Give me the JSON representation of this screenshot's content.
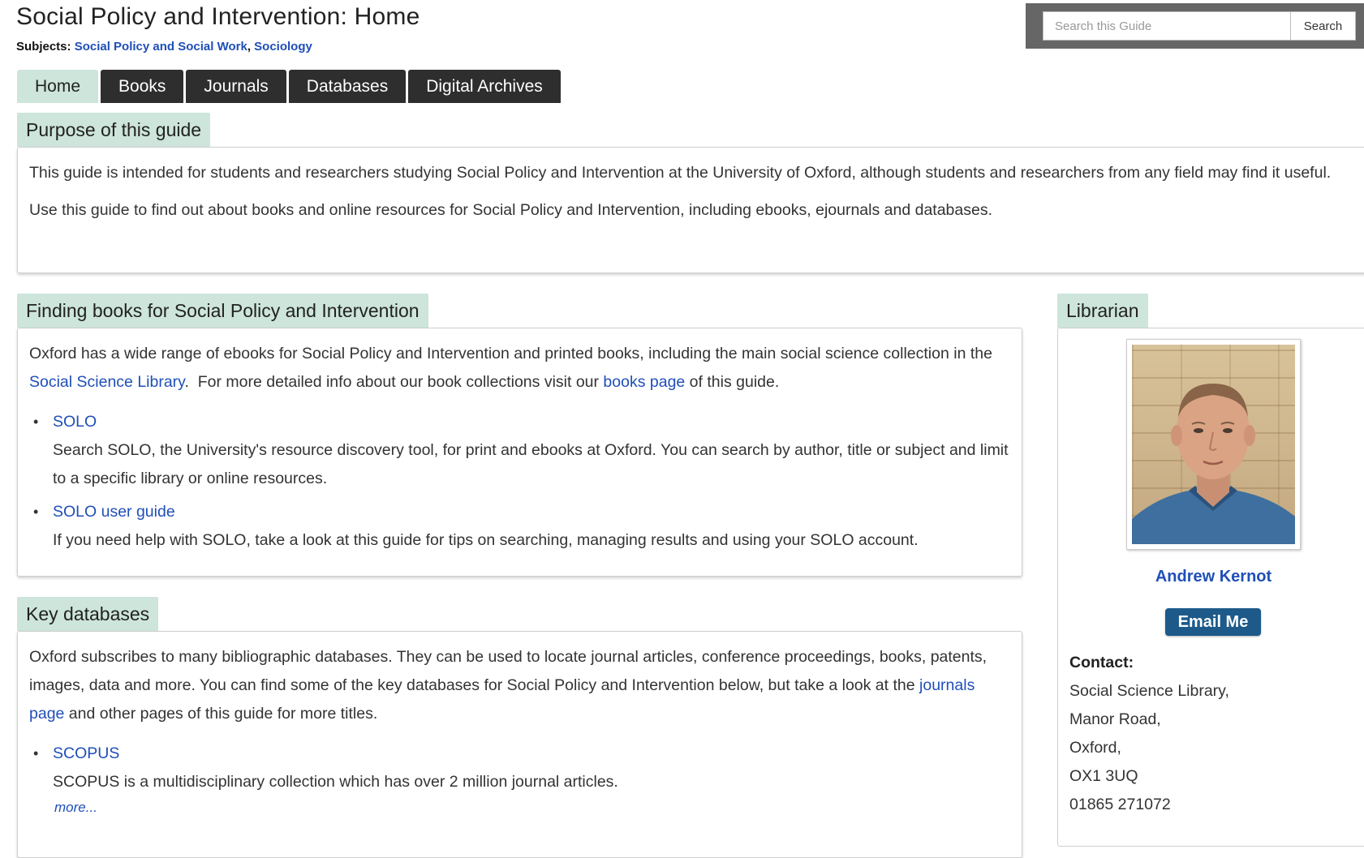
{
  "header": {
    "title": "Social Policy and Intervention: Home",
    "subjects_label": "Subjects:",
    "subjects": [
      {
        "label": "Social Policy and Social Work"
      },
      {
        "label": "Sociology"
      }
    ],
    "subjects_sep": ", "
  },
  "search": {
    "placeholder": "Search this Guide",
    "button_label": "Search"
  },
  "tabs": [
    {
      "label": "Home",
      "active": true
    },
    {
      "label": "Books",
      "active": false
    },
    {
      "label": "Journals",
      "active": false
    },
    {
      "label": "Databases",
      "active": false
    },
    {
      "label": "Digital Archives",
      "active": false
    }
  ],
  "purpose": {
    "heading": "Purpose of this guide",
    "p1": "This guide is intended for students and researchers studying Social Policy and Intervention at the University of Oxford, although students and researchers from any field may find it useful.",
    "p2": "Use this guide to find out about books and online resources for Social Policy and Intervention, including ebooks, ejournals and databases."
  },
  "finding_books": {
    "heading": "Finding books for Social Policy and Intervention",
    "intro_part1": "Oxford has a wide range of ebooks for Social Policy and Intervention and printed books, including the main social science collection in the ",
    "intro_link1": "Social Science Library",
    "intro_part2": ".  For more detailed info about our book collections visit our ",
    "intro_link2": "books page",
    "intro_part3": " of this guide.",
    "items": [
      {
        "title": "SOLO",
        "desc": "Search SOLO, the University's resource discovery tool, for print and ebooks at Oxford. You can search by author, title or subject and limit to a specific library or online resources."
      },
      {
        "title": "SOLO user guide",
        "desc": "If you need help with SOLO, take a look at this guide for tips on searching, managing results and using your SOLO account."
      }
    ]
  },
  "key_databases": {
    "heading": "Key databases",
    "intro_part1": "Oxford subscribes to many bibliographic databases. They can be used to locate journal articles, conference proceedings, books, patents, images, data and more. You can find some of the key databases for Social Policy and Intervention below, but take a look at the ",
    "intro_link": "journals page",
    "intro_part2": " and other pages of this guide for more titles.",
    "items": [
      {
        "title": "SCOPUS",
        "desc": "SCOPUS is a multidisciplinary collection which has over 2 million journal articles.",
        "more": "more..."
      }
    ]
  },
  "librarian": {
    "heading": "Librarian",
    "name": "Andrew Kernot",
    "email_label": "Email Me",
    "contact_label": "Contact:",
    "contact_lines": [
      "Social Science Library,",
      "Manor Road,",
      "Oxford,",
      "OX1 3UQ",
      "01865 271072"
    ]
  },
  "colors": {
    "heading_bg": "#cde5da",
    "tab_bg": "#2e2e2e",
    "link": "#1f4fb8",
    "email_button": "#1d5a8a",
    "search_bar_bg": "#666666"
  },
  "icons": {
    "bullet": "•"
  }
}
